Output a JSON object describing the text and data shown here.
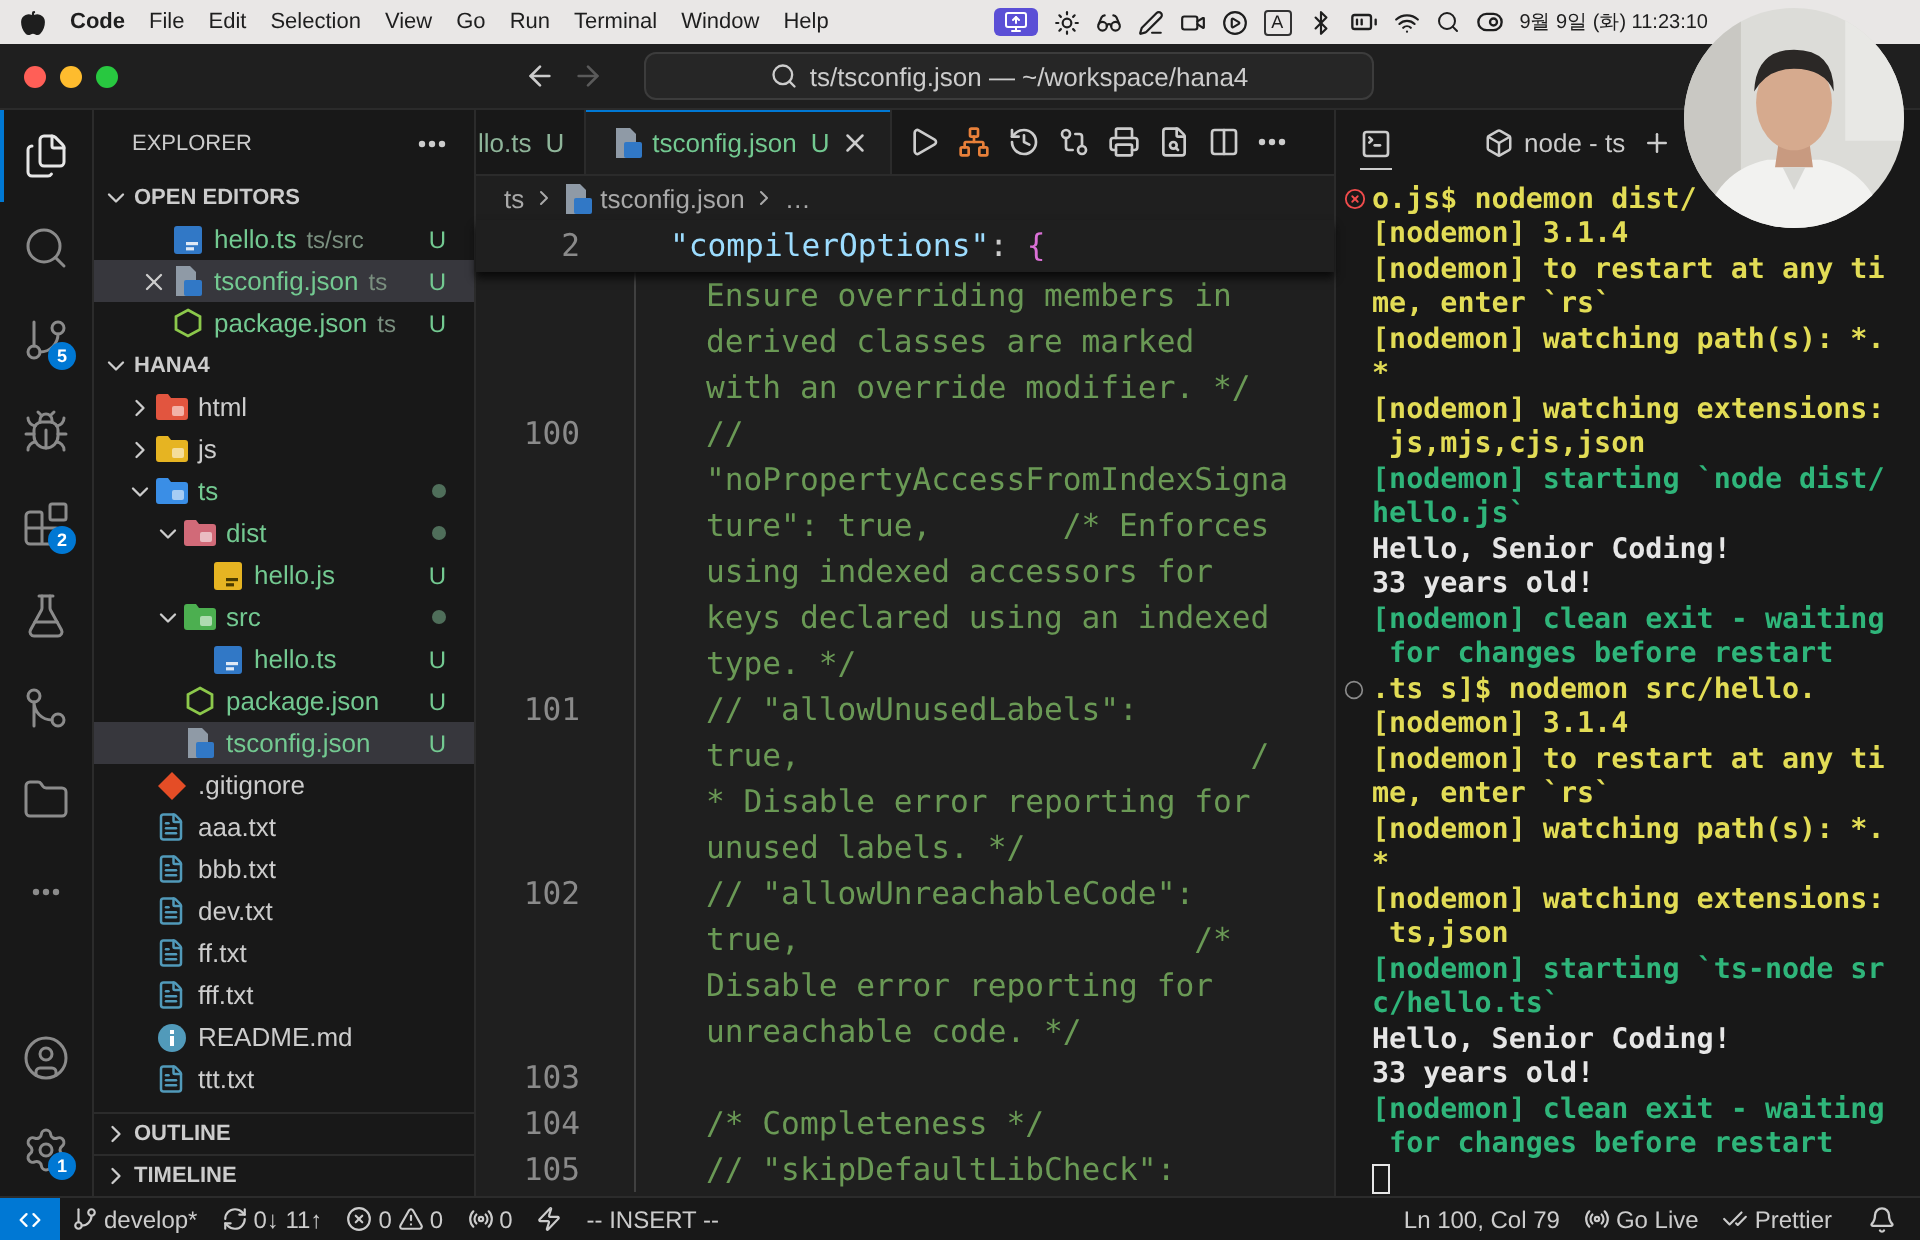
{
  "menu_bar": {
    "app": "Code",
    "items": [
      "File",
      "Edit",
      "Selection",
      "View",
      "Go",
      "Run",
      "Terminal",
      "Window",
      "Help"
    ],
    "input_source": "A",
    "clock": "9월 9일 (화) 11:23:10"
  },
  "title_bar": {
    "command_center": "ts/tsconfig.json — ~/workspace/hana4"
  },
  "activity_bar": {
    "top": [
      {
        "kind": "files",
        "selected": true
      },
      {
        "kind": "search",
        "selected": false
      },
      {
        "kind": "source-control",
        "selected": false,
        "badge": "5"
      },
      {
        "kind": "debug",
        "selected": false
      },
      {
        "kind": "extensions",
        "selected": false,
        "badge": "2"
      },
      {
        "kind": "testing",
        "selected": false
      },
      {
        "kind": "git-graph",
        "selected": false
      },
      {
        "kind": "folder",
        "selected": false
      },
      {
        "kind": "more",
        "selected": false
      }
    ],
    "bottom": [
      {
        "kind": "account",
        "selected": false
      },
      {
        "kind": "settings",
        "selected": false,
        "badge": "1"
      }
    ]
  },
  "explorer": {
    "title": "EXPLORER",
    "sections": [
      {
        "title": "OPEN EDITORS",
        "expanded": true,
        "items": [
          {
            "name": "hello.ts",
            "description": "ts/src",
            "badge": "U",
            "kind": "ts",
            "selected": false
          },
          {
            "name": "tsconfig.json",
            "description": "ts",
            "badge": "U",
            "kind": "tsconfig",
            "selected": true
          },
          {
            "name": "package.json",
            "description": "ts",
            "badge": "U",
            "kind": "package",
            "selected": false
          }
        ]
      },
      {
        "title": "HANA4",
        "expanded": true,
        "tree": [
          {
            "name": "html",
            "kind": "folder-html",
            "expanded": false,
            "selected": false
          },
          {
            "name": "js",
            "kind": "folder-js",
            "expanded": false,
            "selected": false
          },
          {
            "name": "ts",
            "kind": "folder-ts",
            "expanded": true,
            "modified": true,
            "selected": false,
            "children": [
              {
                "name": "dist",
                "kind": "folder-dist",
                "expanded": true,
                "modified": true,
                "selected": false,
                "children": [
                  {
                    "name": "hello.js",
                    "kind": "js",
                    "badge": "U",
                    "selected": false
                  }
                ]
              },
              {
                "name": "src",
                "kind": "folder-src",
                "expanded": true,
                "modified": true,
                "selected": false,
                "children": [
                  {
                    "name": "hello.ts",
                    "kind": "ts",
                    "badge": "U",
                    "selected": false
                  }
                ]
              },
              {
                "name": "package.json",
                "kind": "package",
                "badge": "U",
                "selected": false
              },
              {
                "name": "tsconfig.json",
                "kind": "tsconfig",
                "badge": "U",
                "selected": true
              }
            ]
          },
          {
            "name": ".gitignore",
            "kind": "git",
            "selected": false
          },
          {
            "name": "aaa.txt",
            "kind": "txt",
            "selected": false
          },
          {
            "name": "bbb.txt",
            "kind": "txt",
            "selected": false
          },
          {
            "name": "dev.txt",
            "kind": "txt",
            "selected": false
          },
          {
            "name": "ff.txt",
            "kind": "txt",
            "selected": false
          },
          {
            "name": "fff.txt",
            "kind": "txt",
            "selected": false
          },
          {
            "name": "README.md",
            "kind": "info",
            "selected": false
          },
          {
            "name": "ttt.txt",
            "kind": "txt",
            "selected": false
          }
        ]
      },
      {
        "title": "OUTLINE",
        "expanded": false
      },
      {
        "title": "TIMELINE",
        "expanded": false
      }
    ]
  },
  "editor": {
    "tabs": [
      {
        "label": "llo.ts",
        "badge": "U",
        "selected": false
      },
      {
        "label": "tsconfig.json",
        "kind": "tsconfig",
        "badge": "U",
        "selected": true
      }
    ],
    "breadcrumb": [
      {
        "text": "ts"
      },
      {
        "text": "tsconfig.json",
        "kind": "tsconfig"
      },
      {
        "text": "…"
      }
    ],
    "sticky_line": {
      "number": "2",
      "tokens": [
        {
          "text": "\"compilerOptions\"",
          "kind": "key"
        },
        {
          "text": ": ",
          "kind": "plain"
        },
        {
          "text": "{",
          "kind": "brace"
        }
      ]
    },
    "rows": [
      {
        "text": "Ensure overriding members in"
      },
      {
        "text": "derived classes are marked"
      },
      {
        "text": "with an override modifier. */"
      },
      {
        "number": "100",
        "text": "//"
      },
      {
        "text": "\"noPropertyAccessFromIndexSigna"
      },
      {
        "text": "ture\": true,       /* Enforces"
      },
      {
        "text": "using indexed accessors for"
      },
      {
        "text": "keys declared using an indexed"
      },
      {
        "text": "type. */"
      },
      {
        "number": "101",
        "text": "// \"allowUnusedLabels\":"
      },
      {
        "text": "true,                        /"
      },
      {
        "text": "* Disable error reporting for"
      },
      {
        "text": "unused labels. */"
      },
      {
        "number": "102",
        "text": "// \"allowUnreachableCode\":"
      },
      {
        "text": "true,                     /*"
      },
      {
        "text": "Disable error reporting for"
      },
      {
        "text": "unreachable code. */"
      },
      {
        "number": "103"
      },
      {
        "number": "104",
        "text": "/* Completeness */"
      },
      {
        "number": "105",
        "text": "// \"skipDefaultLibCheck\":"
      }
    ]
  },
  "terminal": {
    "title": "node - ts",
    "lines": [
      {
        "text": "o.js$ nodemon dist/",
        "color": "#e2dc55",
        "kind": "failed-command"
      },
      {
        "text": "[nodemon] 3.1.4",
        "color": "#e2dc55"
      },
      {
        "text": "[nodemon] to restart at any ti",
        "color": "#e2dc55"
      },
      {
        "text": "me, enter `rs`",
        "color": "#e2dc55"
      },
      {
        "text": "[nodemon] watching path(s): *.",
        "color": "#e2dc55"
      },
      {
        "text": "*",
        "color": "#e2dc55"
      },
      {
        "text": "[nodemon] watching extensions:",
        "color": "#e2dc55"
      },
      {
        "text": " js,mjs,cjs,json",
        "color": "#e2dc55"
      },
      {
        "text": "[nodemon] starting `node dist/",
        "color": "#2fb57a"
      },
      {
        "text": "hello.js`",
        "color": "#2fb57a"
      },
      {
        "text": "Hello, Senior Coding!",
        "color": "#e6e6e6"
      },
      {
        "text": "33 years old!",
        "color": "#e6e6e6"
      },
      {
        "text": "[nodemon] clean exit - waiting",
        "color": "#2fb57a"
      },
      {
        "text": " for changes before restart",
        "color": "#2fb57a"
      },
      {
        "text": ".ts s]$ nodemon src/hello.",
        "color": "#e2dc55",
        "kind": "command"
      },
      {
        "text": "[nodemon] 3.1.4",
        "color": "#e2dc55"
      },
      {
        "text": "[nodemon] to restart at any ti",
        "color": "#e2dc55"
      },
      {
        "text": "me, enter `rs`",
        "color": "#e2dc55"
      },
      {
        "text": "[nodemon] watching path(s): *.",
        "color": "#e2dc55"
      },
      {
        "text": "*",
        "color": "#e2dc55"
      },
      {
        "text": "[nodemon] watching extensions:",
        "color": "#e2dc55"
      },
      {
        "text": " ts,json",
        "color": "#e2dc55"
      },
      {
        "text": "[nodemon] starting `ts-node sr",
        "color": "#2fb57a"
      },
      {
        "text": "c/hello.ts`",
        "color": "#2fb57a"
      },
      {
        "text": "Hello, Senior Coding!",
        "color": "#e6e6e6"
      },
      {
        "text": "33 years old!",
        "color": "#e6e6e6"
      },
      {
        "text": "[nodemon] clean exit - waiting",
        "color": "#2fb57a"
      },
      {
        "text": " for changes before restart",
        "color": "#2fb57a"
      }
    ]
  },
  "status_bar": {
    "left": [
      {
        "kind": "remote"
      },
      {
        "kind": "branch",
        "text": "develop*"
      },
      {
        "kind": "sync",
        "text": "0↓ 11↑"
      },
      {
        "kind": "problems",
        "errors": "0",
        "warnings": "0"
      },
      {
        "kind": "ports",
        "text": "0"
      },
      {
        "kind": "lightning"
      },
      {
        "kind": "mode",
        "text": "-- INSERT --"
      }
    ],
    "right": [
      {
        "kind": "position",
        "text": "Ln 100, Col 79"
      },
      {
        "kind": "live",
        "text": "Go Live"
      },
      {
        "kind": "prettier",
        "text": "Prettier"
      },
      {
        "kind": "bell"
      }
    ]
  }
}
